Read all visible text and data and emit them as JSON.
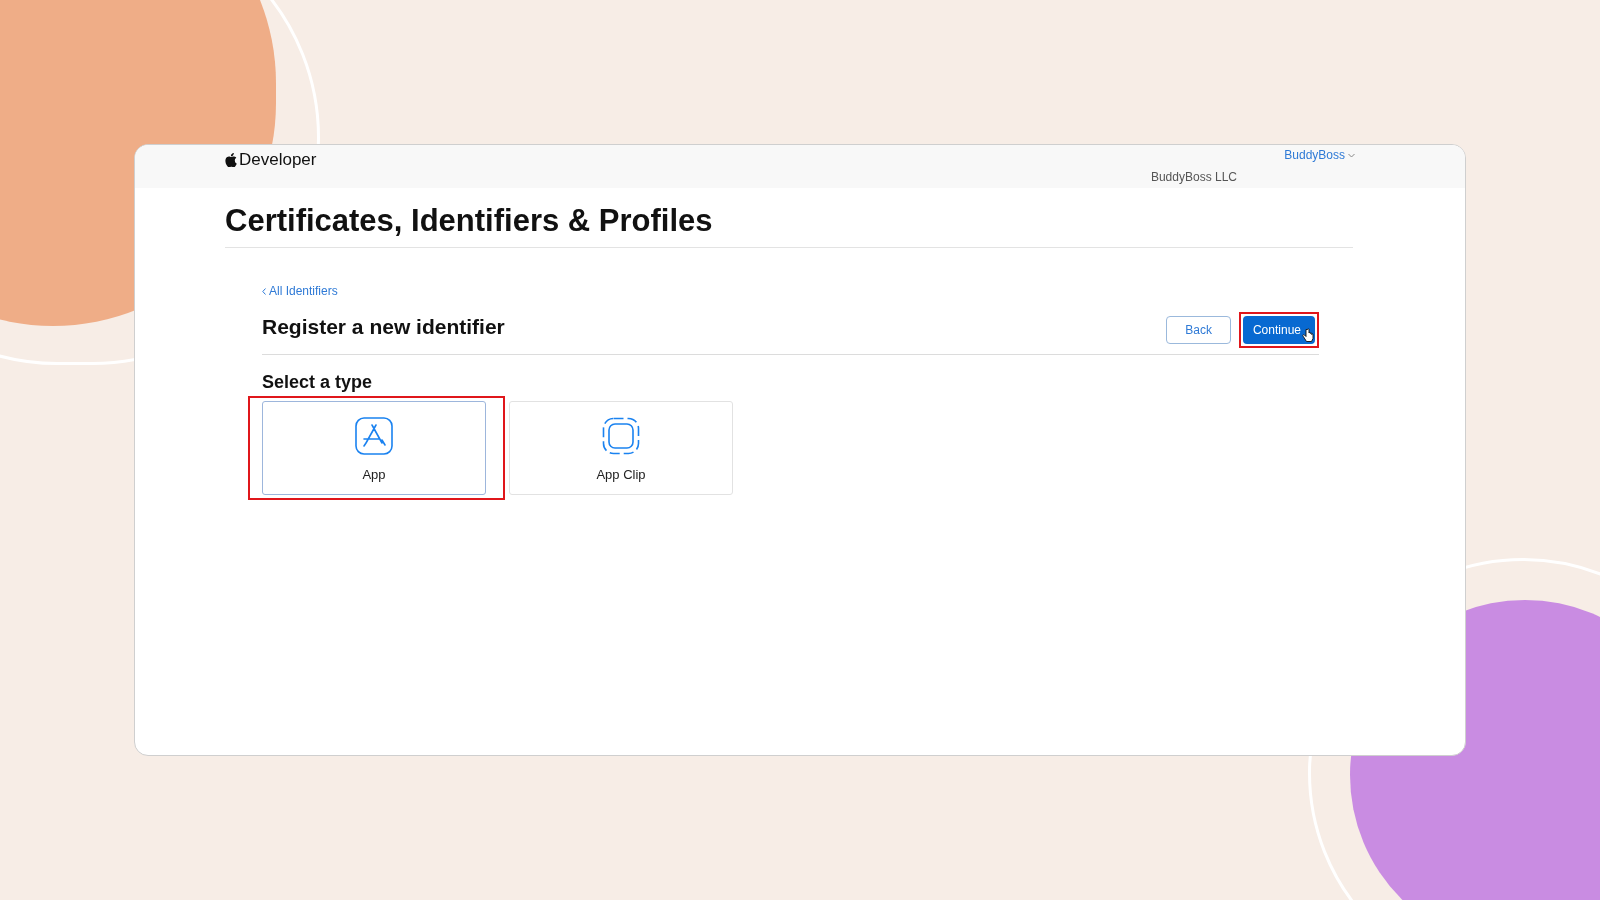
{
  "header": {
    "brand": "Developer",
    "account": "BuddyBoss",
    "team": "BuddyBoss LLC"
  },
  "page_title": "Certificates, Identifiers & Profiles",
  "back_link": "All Identifiers",
  "section_title": "Register a new identifier",
  "buttons": [
    {
      "label": "Back",
      "kind": "secondary",
      "highlighted": false
    },
    {
      "label": "Continue",
      "kind": "primary",
      "highlighted": true
    }
  ],
  "select_label": "Select a type",
  "types": [
    {
      "label": "App",
      "kind": "app",
      "selected": true,
      "highlighted": true
    },
    {
      "label": "App Clip",
      "kind": "appclip",
      "selected": false,
      "highlighted": false
    }
  ]
}
